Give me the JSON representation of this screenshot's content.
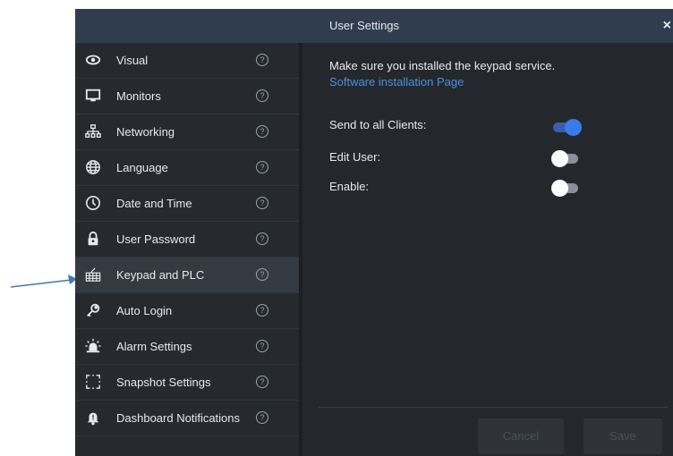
{
  "window": {
    "title": "User Settings",
    "close_label": "×"
  },
  "sidebar": {
    "items": [
      {
        "label": "Visual",
        "icon": "eye-icon",
        "active": false
      },
      {
        "label": "Monitors",
        "icon": "monitor-icon",
        "active": false
      },
      {
        "label": "Networking",
        "icon": "network-icon",
        "active": false
      },
      {
        "label": "Language",
        "icon": "globe-icon",
        "active": false
      },
      {
        "label": "Date and Time",
        "icon": "clock-icon",
        "active": false
      },
      {
        "label": "User Password",
        "icon": "lock-icon",
        "active": false
      },
      {
        "label": "Keypad and PLC",
        "icon": "keypad-icon",
        "active": true
      },
      {
        "label": "Auto Login",
        "icon": "key-icon",
        "active": false
      },
      {
        "label": "Alarm Settings",
        "icon": "alarm-light-icon",
        "active": false
      },
      {
        "label": "Snapshot Settings",
        "icon": "snapshot-icon",
        "active": false
      },
      {
        "label": "Dashboard Notifications",
        "icon": "bell-icon",
        "active": false
      }
    ],
    "help_label": "?"
  },
  "main": {
    "message": "Make sure you installed the keypad service.",
    "link": "Software installation Page",
    "settings": [
      {
        "label": "Send to all Clients:",
        "on": true
      },
      {
        "label": "Edit User:",
        "on": false
      },
      {
        "label": "Enable:",
        "on": false
      }
    ],
    "buttons": {
      "cancel": "Cancel",
      "save": "Save"
    }
  },
  "colors": {
    "titlebar": "#2f3d4f",
    "panel": "#24282c",
    "link": "#4a8fe0",
    "toggle_on": "#3a7be8",
    "arrow": "#3e78b8"
  }
}
